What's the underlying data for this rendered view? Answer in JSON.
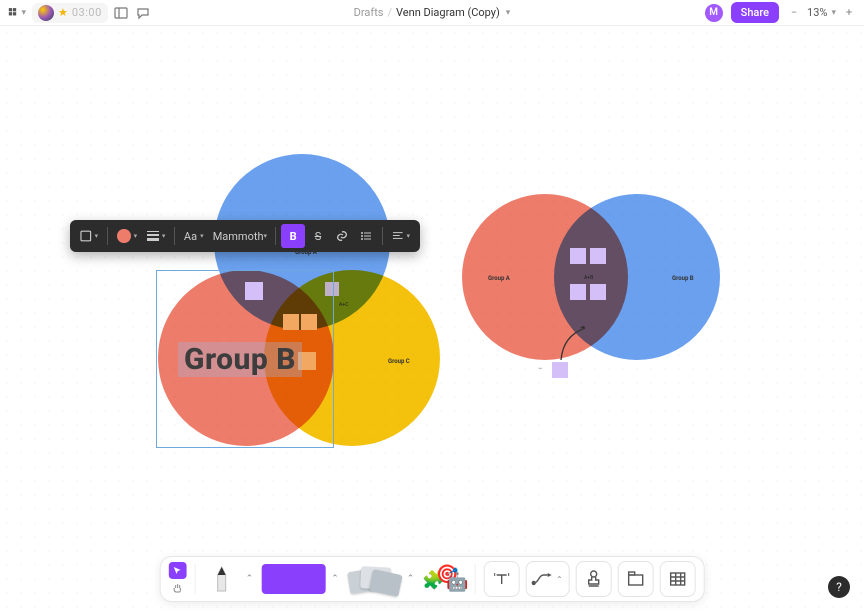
{
  "topbar": {
    "timer": "03:00",
    "breadcrumb": {
      "root": "Drafts",
      "name": "Venn Diagram (Copy)"
    },
    "avatar_initial": "M",
    "share_label": "Share",
    "zoom": "13%"
  },
  "ctx_toolbar": {
    "font": "Mammoth",
    "text_size_label": "Aa",
    "bold_label": "B",
    "strike_label": "S"
  },
  "canvas": {
    "left_venn": {
      "groupA": "Group A",
      "groupB": "Group B",
      "groupC": "Group C",
      "overlap_ac": "A+C",
      "big_text_editing": "Group B"
    },
    "right_venn": {
      "groupA": "Group A",
      "groupB": "Group B",
      "overlap_ab": "A+B"
    }
  },
  "help_label": "?"
}
